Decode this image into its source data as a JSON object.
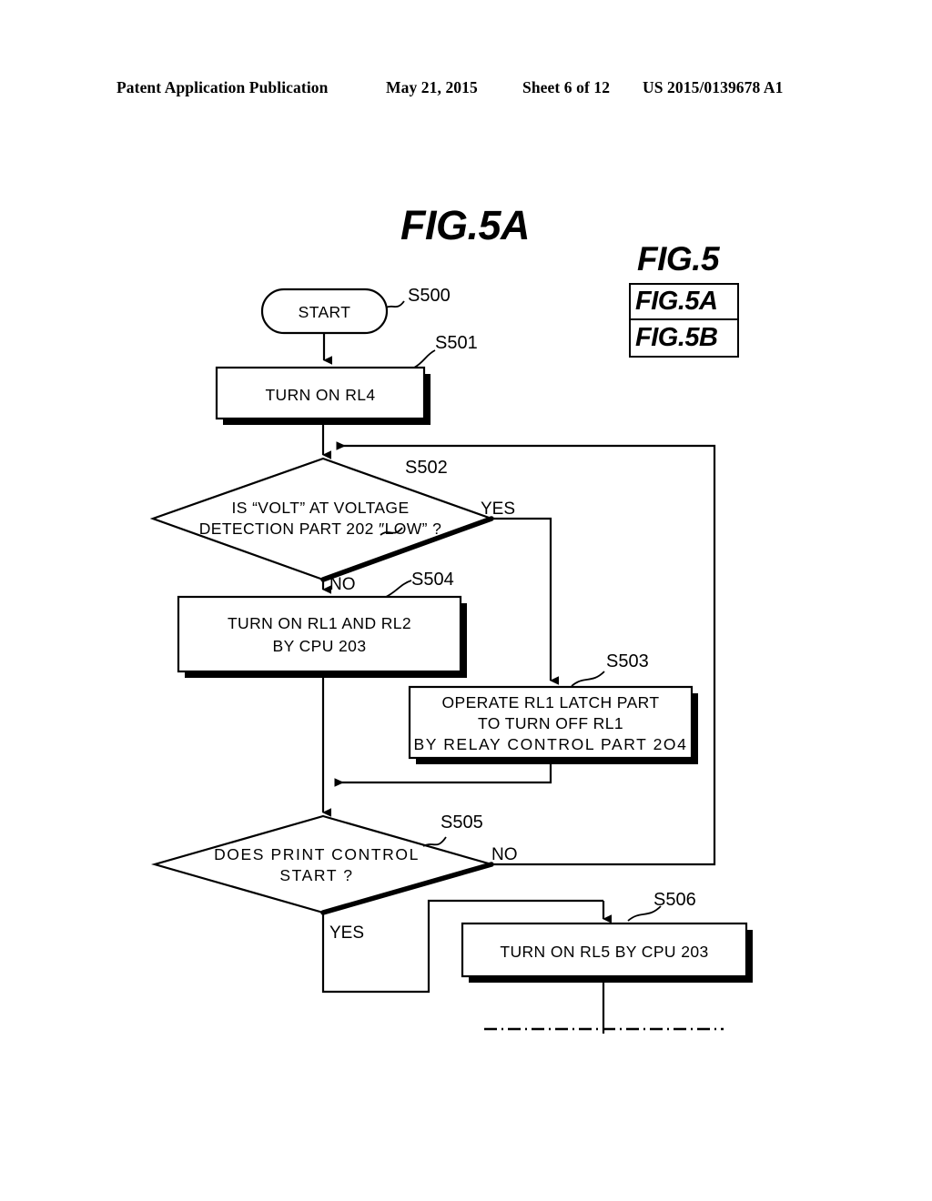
{
  "header": {
    "publication": "Patent Application Publication",
    "date": "May 21, 2015",
    "sheet": "Sheet 6 of 12",
    "patent_number": "US 2015/0139678 A1"
  },
  "figure": {
    "main_title": "FIG.5A",
    "index_title": "FIG.5",
    "index_rows": [
      "FIG.5A",
      "FIG.5B"
    ]
  },
  "flowchart": {
    "type": "flowchart",
    "nodes": [
      {
        "id": "S500",
        "step_label": "S500",
        "shape": "terminator",
        "lines": [
          "START"
        ]
      },
      {
        "id": "S501",
        "step_label": "S501",
        "shape": "process",
        "lines": [
          "TURN ON RL4"
        ]
      },
      {
        "id": "S502",
        "step_label": "S502",
        "shape": "decision",
        "lines": [
          "IS “VOLT” AT VOLTAGE",
          "DETECTION PART 202 ″LOW” ?"
        ]
      },
      {
        "id": "S504",
        "step_label": "S504",
        "shape": "process",
        "lines": [
          "TURN ON RL1 AND RL2",
          "BY CPU 203"
        ]
      },
      {
        "id": "S503",
        "step_label": "S503",
        "shape": "process",
        "lines": [
          "OPERATE  RL1 LATCH PART",
          "TO TURN OFF RL1",
          "BY RELAY  CONTROL  PART  2O4"
        ]
      },
      {
        "id": "S505",
        "step_label": "S505",
        "shape": "decision",
        "lines": [
          "DOES  PRINT  CONTROL",
          "START  ?"
        ]
      },
      {
        "id": "S506",
        "step_label": "S506",
        "shape": "process",
        "lines": [
          "TURN ON RL5 BY CPU 203"
        ]
      }
    ],
    "branch_labels": {
      "s502_yes": "YES",
      "s502_no": "NO",
      "s505_yes": "YES",
      "s505_no": "NO"
    },
    "colors": {
      "line": "#000000",
      "fill": "#ffffff"
    }
  }
}
